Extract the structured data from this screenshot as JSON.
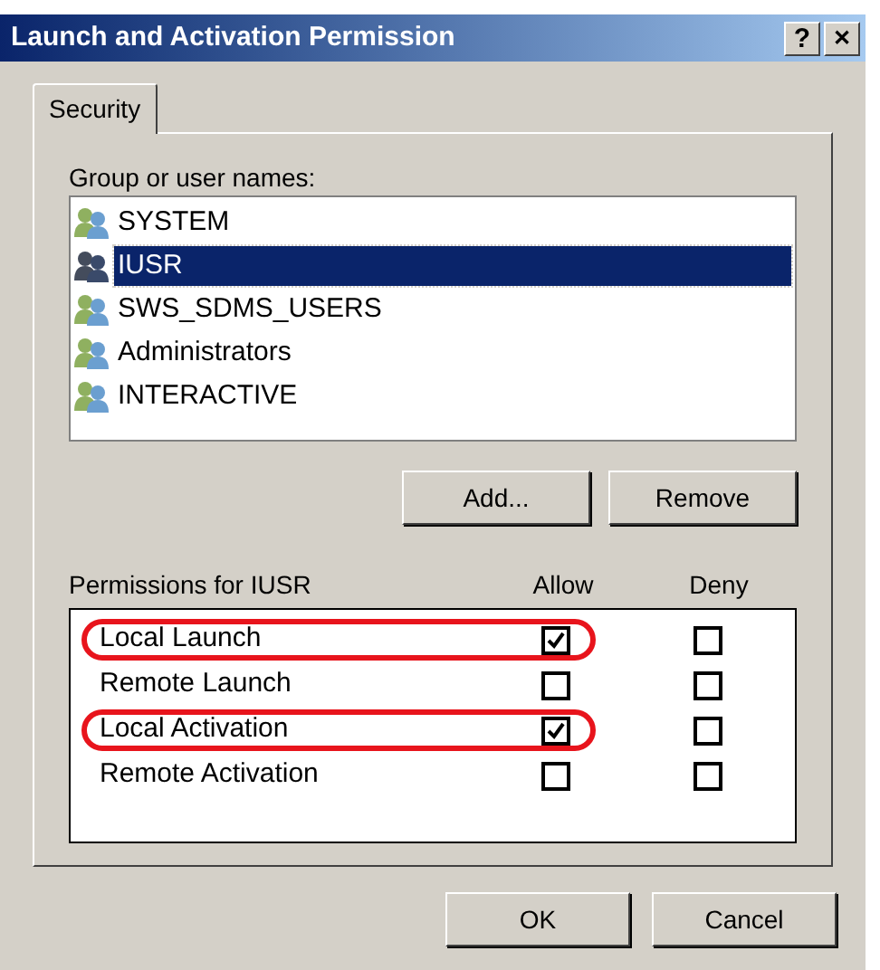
{
  "window": {
    "title": "Launch and Activation Permission"
  },
  "title_buttons": [
    {
      "kind": "help",
      "label": "?"
    },
    {
      "kind": "close",
      "label": "✕"
    }
  ],
  "tabs": [
    {
      "label": "Security",
      "selected": true
    }
  ],
  "group_label": "Group or user names:",
  "users": [
    {
      "name": "SYSTEM",
      "selected": false
    },
    {
      "name": "IUSR",
      "selected": true
    },
    {
      "name": "SWS_SDMS_USERS",
      "selected": false
    },
    {
      "name": "Administrators",
      "selected": false
    },
    {
      "name": "INTERACTIVE",
      "selected": false
    }
  ],
  "user_buttons": [
    "Add...",
    "Remove"
  ],
  "permissions": {
    "label": "Permissions for IUSR",
    "columns": [
      "Allow",
      "Deny"
    ],
    "rows": [
      {
        "name": "Local Launch",
        "allow": true,
        "deny": false,
        "highlighted": true
      },
      {
        "name": "Remote Launch",
        "allow": false,
        "deny": false,
        "highlighted": false
      },
      {
        "name": "Local Activation",
        "allow": true,
        "deny": false,
        "highlighted": true
      },
      {
        "name": "Remote Activation",
        "allow": false,
        "deny": false,
        "highlighted": false
      }
    ]
  },
  "dialog_buttons": [
    "OK",
    "Cancel"
  ]
}
